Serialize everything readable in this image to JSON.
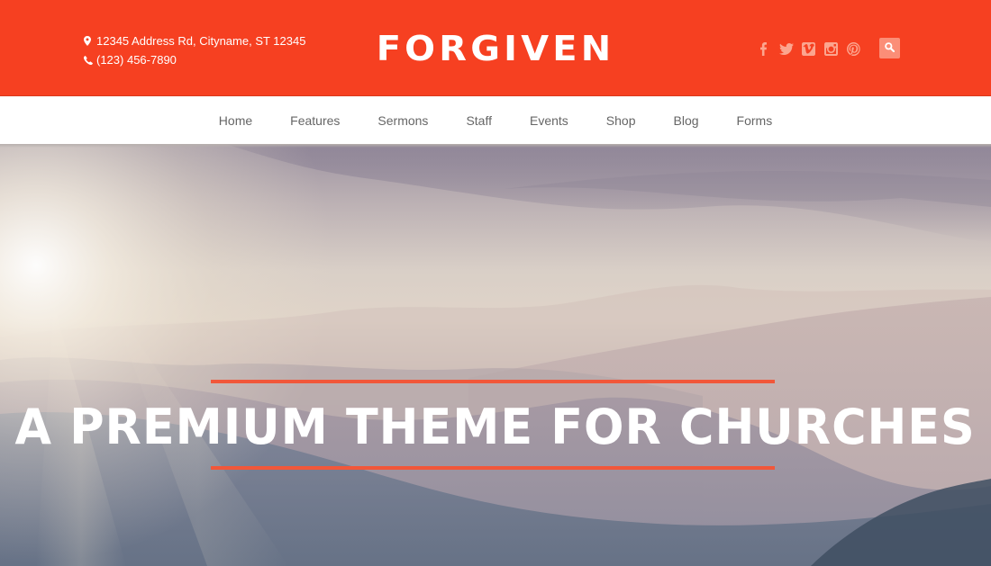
{
  "header": {
    "address": "12345 Address Rd, Cityname, ST 12345",
    "phone": "(123) 456-7890",
    "logo": "FORGIVEN",
    "social": [
      {
        "name": "facebook",
        "icon": "facebook-icon"
      },
      {
        "name": "twitter",
        "icon": "twitter-icon"
      },
      {
        "name": "vimeo",
        "icon": "vimeo-icon"
      },
      {
        "name": "instagram",
        "icon": "instagram-icon"
      },
      {
        "name": "pinterest",
        "icon": "pinterest-icon"
      }
    ],
    "search_icon": "search-icon"
  },
  "nav": {
    "items": [
      {
        "label": "Home"
      },
      {
        "label": "Features"
      },
      {
        "label": "Sermons"
      },
      {
        "label": "Staff"
      },
      {
        "label": "Events"
      },
      {
        "label": "Shop"
      },
      {
        "label": "Blog"
      },
      {
        "label": "Forms"
      }
    ]
  },
  "hero": {
    "headline": "A PREMIUM THEME FOR CHURCHES"
  },
  "colors": {
    "brand": "#f64021",
    "accent_rule": "#f1573a",
    "nav_text": "#666666"
  }
}
